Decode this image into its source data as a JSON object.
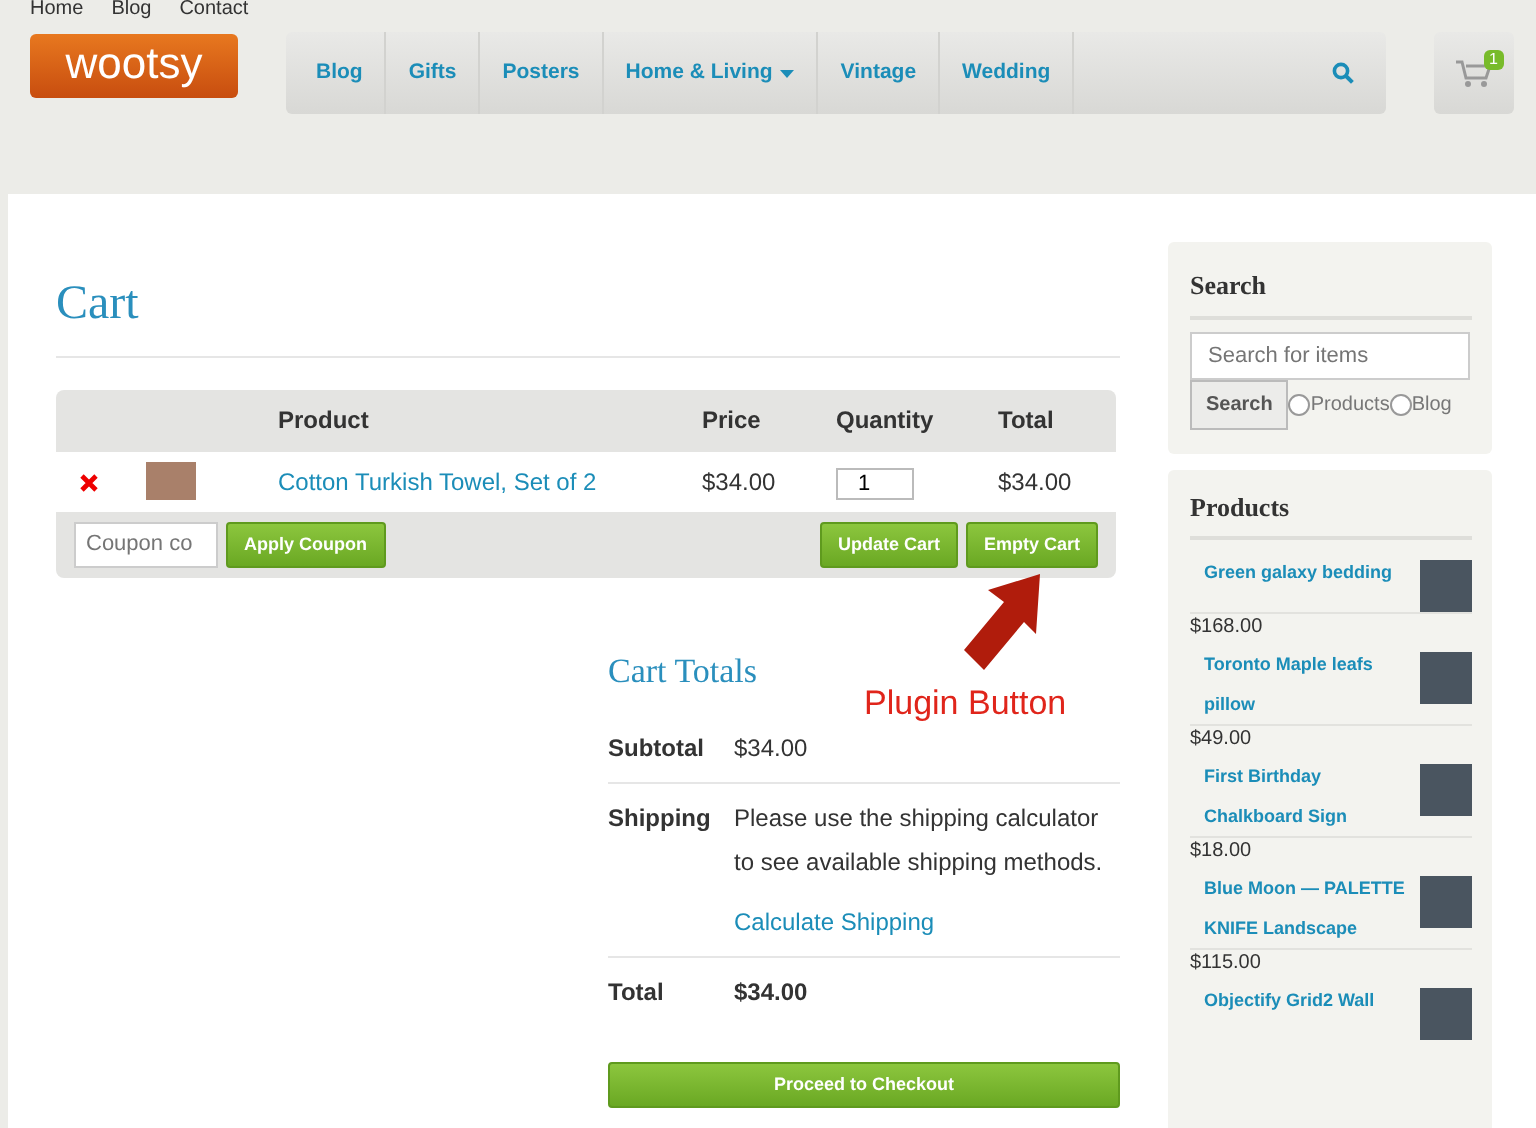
{
  "top_links": [
    "Home",
    "Blog",
    "Contact"
  ],
  "logo": "wootsy",
  "nav": [
    {
      "label": "Blog",
      "dropdown": false
    },
    {
      "label": "Gifts",
      "dropdown": false
    },
    {
      "label": "Posters",
      "dropdown": false
    },
    {
      "label": "Home & Living",
      "dropdown": true
    },
    {
      "label": "Vintage",
      "dropdown": false
    },
    {
      "label": "Wedding",
      "dropdown": false
    }
  ],
  "cart_count": "1",
  "page_title": "Cart",
  "cart_table": {
    "columns": [
      "Product",
      "Price",
      "Quantity",
      "Total"
    ],
    "rows": [
      {
        "product": "Cotton Turkish Towel, Set of 2",
        "price": "$34.00",
        "quantity": "1",
        "total": "$34.00"
      }
    ]
  },
  "coupon": {
    "placeholder": "Coupon co",
    "button": "Apply Coupon"
  },
  "cart_buttons": [
    "Update Cart",
    "Empty Cart"
  ],
  "annotation": "Plugin Button",
  "cart_totals": {
    "title": "Cart Totals",
    "rows": [
      {
        "kind": "plain",
        "label": "Subtotal",
        "value": "$34.00"
      },
      {
        "kind": "shipping",
        "label": "Shipping",
        "value": "Please use the shipping calculator to see available shipping methods.",
        "link": "Calculate Shipping"
      },
      {
        "kind": "total",
        "label": "Total",
        "value": "$34.00"
      }
    ],
    "checkout": "Proceed to Checkout"
  },
  "sidebar": {
    "search": {
      "title": "Search",
      "placeholder": "Search for items",
      "button": "Search",
      "scopes": [
        {
          "label": "Products",
          "selected": false
        },
        {
          "label": "Blog",
          "selected": false
        }
      ]
    },
    "products": {
      "title": "Products",
      "items": [
        {
          "name": "Green galaxy bedding",
          "price": "$168.00"
        },
        {
          "name": "Toronto Maple leafs pillow",
          "price": "$49.00"
        },
        {
          "name": "First Birthday Chalkboard Sign",
          "price": "$18.00"
        },
        {
          "name": "Blue Moon — PALETTE KNIFE Landscape",
          "price": "$115.00"
        },
        {
          "name": "Objectify Grid2 Wall"
        }
      ]
    }
  }
}
